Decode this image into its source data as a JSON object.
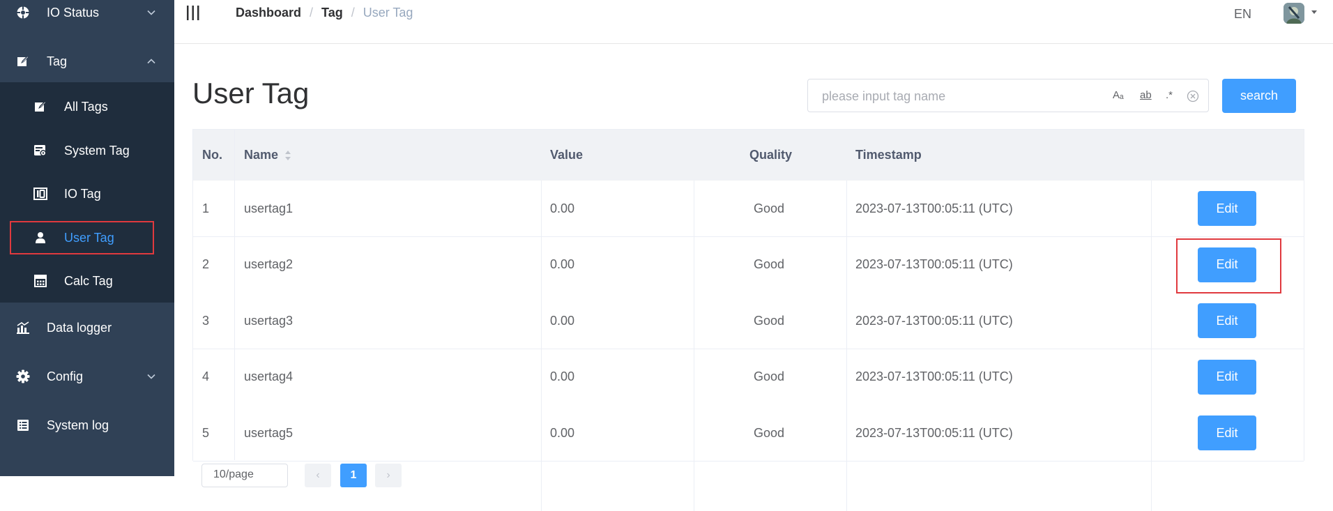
{
  "sidebar": {
    "io_status": "IO Status",
    "tag": "Tag",
    "all_tags": "All Tags",
    "system_tag": "System Tag",
    "io_tag": "IO Tag",
    "user_tag": "User Tag",
    "calc_tag": "Calc Tag",
    "data_logger": "Data logger",
    "config": "Config",
    "system_log": "System log"
  },
  "header": {
    "breadcrumb": [
      "Dashboard",
      "Tag",
      "User Tag"
    ],
    "separator": "/",
    "language": "EN"
  },
  "main": {
    "title": "User Tag",
    "search": {
      "placeholder": "please input tag name",
      "value": "",
      "button": "search"
    },
    "search_options": [
      "Aₐ",
      "ab",
      ".*"
    ],
    "table": {
      "headers": {
        "no": "No.",
        "name": "Name",
        "value": "Value",
        "quality": "Quality",
        "timestamp": "Timestamp"
      },
      "rows": [
        {
          "no": "1",
          "name": "usertag1",
          "value": "0.00",
          "quality": "Good",
          "timestamp": "2023-07-13T00:05:11 (UTC)",
          "action": "Edit"
        },
        {
          "no": "2",
          "name": "usertag2",
          "value": "0.00",
          "quality": "Good",
          "timestamp": "2023-07-13T00:05:11 (UTC)",
          "action": "Edit"
        },
        {
          "no": "3",
          "name": "usertag3",
          "value": "0.00",
          "quality": "Good",
          "timestamp": "2023-07-13T00:05:11 (UTC)",
          "action": "Edit"
        },
        {
          "no": "4",
          "name": "usertag4",
          "value": "0.00",
          "quality": "Good",
          "timestamp": "2023-07-13T00:05:11 (UTC)",
          "action": "Edit"
        },
        {
          "no": "5",
          "name": "usertag5",
          "value": "0.00",
          "quality": "Good",
          "timestamp": "2023-07-13T00:05:11 (UTC)",
          "action": "Edit"
        }
      ]
    },
    "pagination": {
      "page_size": "10/page",
      "current_page": "1",
      "prev": "‹",
      "next": "›"
    }
  },
  "colors": {
    "sidebar_bg": "#304156",
    "submenu_bg": "#1f2d3d",
    "accent": "#409eff",
    "highlight": "#e0393e"
  },
  "icons": [
    "io-status-icon",
    "tag-icon",
    "all-tags-icon",
    "system-tag-icon",
    "io-tag-icon",
    "user-icon",
    "calc-icon",
    "data-logger-icon",
    "gear-icon",
    "system-log-icon",
    "hamburger-icon",
    "sort-icon",
    "clear-icon"
  ]
}
